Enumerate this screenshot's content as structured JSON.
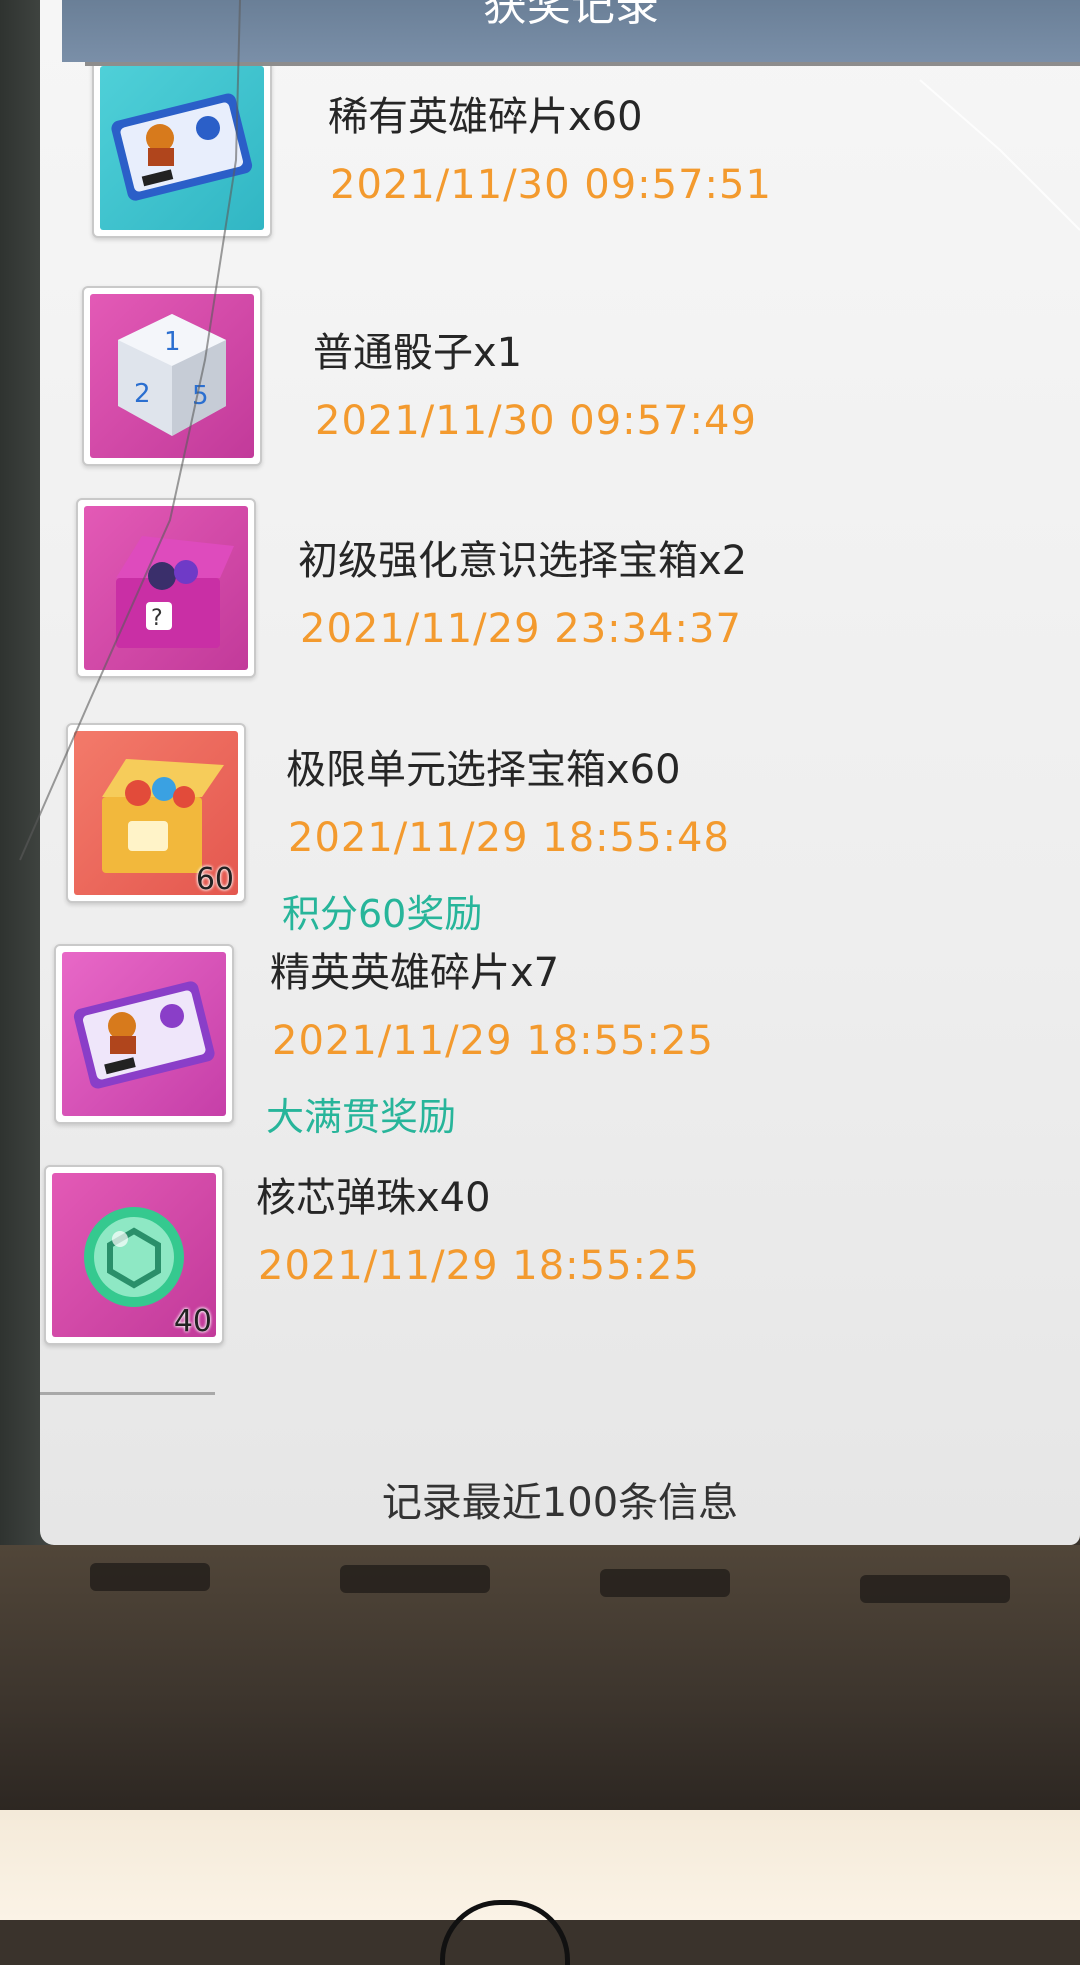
{
  "panel": {
    "title": "获奖记录",
    "footer": "记录最近100条信息"
  },
  "records": [
    {
      "name": "稀有英雄碎片x60",
      "time": "2021/11/30 09:57:51",
      "icon": "rare-hero-shard-ticket-icon"
    },
    {
      "name": "普通骰子x1",
      "time": "2021/11/30 09:57:49",
      "icon": "dice-icon"
    },
    {
      "name": "初级强化意识选择宝箱x2",
      "time": "2021/11/29 23:34:37",
      "icon": "treasure-box-icon"
    },
    {
      "name": "极限单元选择宝箱x60",
      "time": "2021/11/29 18:55:48",
      "note": "积分60奖励",
      "count": "60",
      "icon": "unit-box-icon"
    },
    {
      "name": "精英英雄碎片x7",
      "time": "2021/11/29 18:55:25",
      "note": "大满贯奖励",
      "icon": "elite-hero-shard-ticket-icon"
    },
    {
      "name": "核芯弹珠x40",
      "time": "2021/11/29 18:55:25",
      "count": "40",
      "icon": "core-marble-icon"
    }
  ],
  "colors": {
    "time": "#f39a2e",
    "note": "#27b59a",
    "title_bar": "#6a7f97"
  }
}
